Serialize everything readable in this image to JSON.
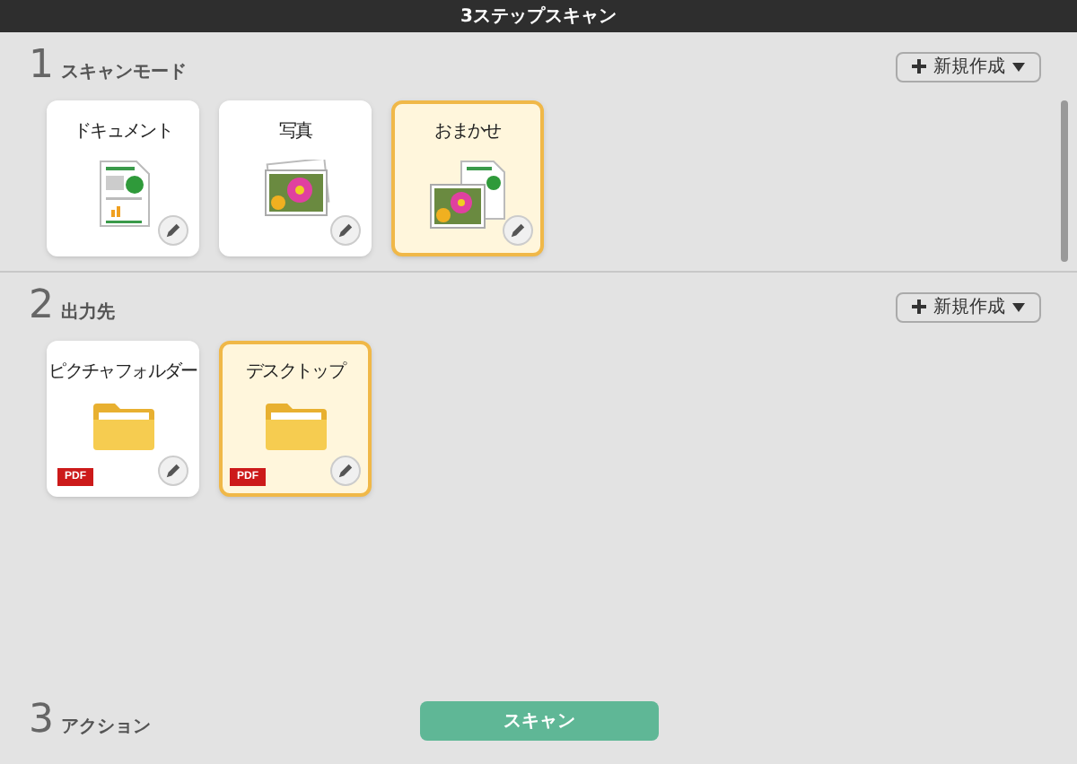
{
  "window": {
    "title": "3ステップスキャン"
  },
  "sections": [
    {
      "number": "1",
      "title": "スキャンモード",
      "new_button": "新規作成",
      "cards": [
        {
          "label": "ドキュメント",
          "kind": "document",
          "selected": false
        },
        {
          "label": "写真",
          "kind": "photo",
          "selected": false
        },
        {
          "label": "おまかせ",
          "kind": "auto",
          "selected": true
        }
      ]
    },
    {
      "number": "2",
      "title": "出力先",
      "new_button": "新規作成",
      "cards": [
        {
          "label": "ピクチャフォルダー",
          "kind": "folder",
          "badge": "PDF",
          "selected": false
        },
        {
          "label": "デスクトップ",
          "kind": "folder",
          "badge": "PDF",
          "selected": true
        }
      ]
    }
  ],
  "action": {
    "number": "3",
    "title": "アクション",
    "button": "スキャン"
  }
}
